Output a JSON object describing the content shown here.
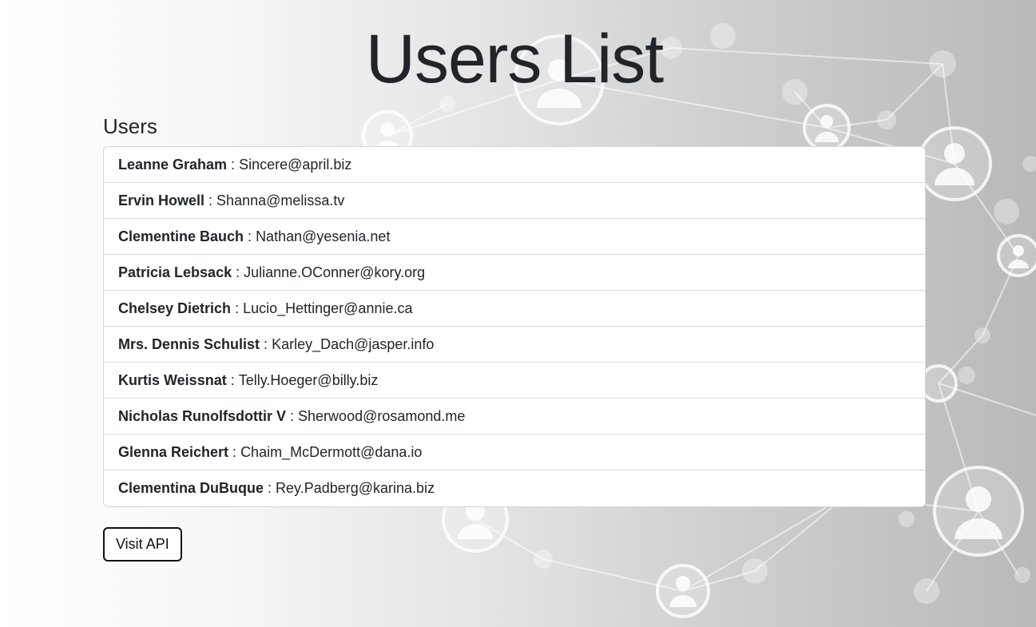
{
  "header": {
    "title": "Users List"
  },
  "users_section": {
    "title": "Users",
    "separator": " : ",
    "users": [
      {
        "name": "Leanne Graham",
        "email": "Sincere@april.biz"
      },
      {
        "name": "Ervin Howell",
        "email": "Shanna@melissa.tv"
      },
      {
        "name": "Clementine Bauch",
        "email": "Nathan@yesenia.net"
      },
      {
        "name": "Patricia Lebsack",
        "email": "Julianne.OConner@kory.org"
      },
      {
        "name": "Chelsey Dietrich",
        "email": "Lucio_Hettinger@annie.ca"
      },
      {
        "name": "Mrs. Dennis Schulist",
        "email": "Karley_Dach@jasper.info"
      },
      {
        "name": "Kurtis Weissnat",
        "email": "Telly.Hoeger@billy.biz"
      },
      {
        "name": "Nicholas Runolfsdottir V",
        "email": "Sherwood@rosamond.me"
      },
      {
        "name": "Glenna Reichert",
        "email": "Chaim_McDermott@dana.io"
      },
      {
        "name": "Clementina DuBuque",
        "email": "Rey.Padberg@karina.biz"
      }
    ]
  },
  "actions": {
    "visit_api_label": "Visit API"
  },
  "background": {
    "image": "network-of-people-icons",
    "icon": "person-icon"
  },
  "colors": {
    "text": "#212529",
    "list_border": "#d6d6d6",
    "button_border": "#111111"
  }
}
